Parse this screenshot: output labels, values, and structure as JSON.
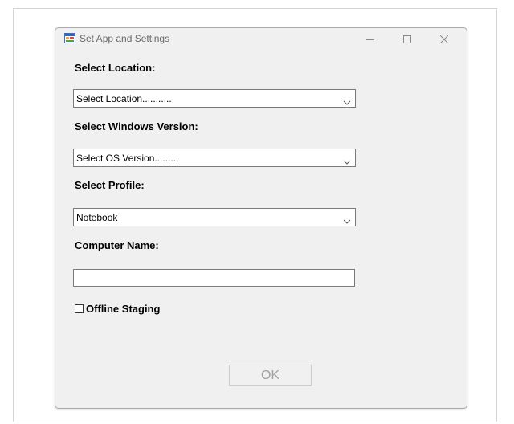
{
  "window": {
    "title": "Set App and Settings",
    "app_icon": "form-app-icon",
    "controls": {
      "minimize_icon": "minimize-icon",
      "maximize_icon": "maximize-icon",
      "close_icon": "close-icon"
    }
  },
  "form": {
    "location": {
      "label": "Select Location:",
      "selected": "Select Location..........."
    },
    "windows_version": {
      "label": "Select Windows Version:",
      "selected": "Select OS Version........."
    },
    "profile": {
      "label": "Select Profile:",
      "selected": "Notebook"
    },
    "computer_name": {
      "label": "Computer Name:",
      "value": ""
    },
    "offline_staging": {
      "label": "Offline Staging",
      "checked": false
    },
    "ok_button": {
      "label": "OK",
      "enabled": false
    }
  },
  "colors": {
    "window_bg": "#f0f0f0",
    "disabled_text": "#a0a0a0",
    "border": "#7a7a7a"
  }
}
